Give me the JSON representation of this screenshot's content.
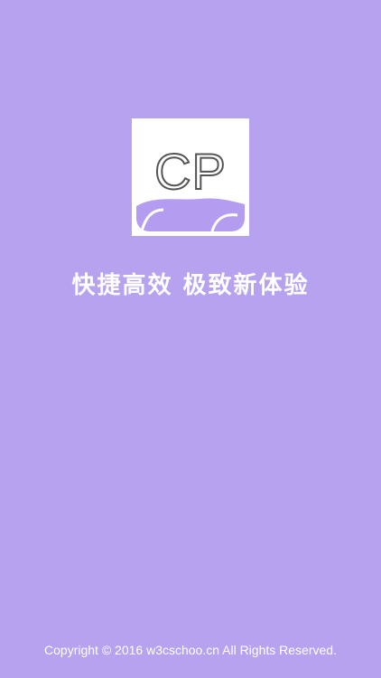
{
  "logo": {
    "text": "CP",
    "icon": "cp-logo-icon"
  },
  "tagline": "快捷高效 极致新体验",
  "footer": {
    "copyright": "Copyright © 2016 w3cschoo.cn All Rights Reserved."
  },
  "colors": {
    "background": "#b6a2ef",
    "logo_wave": "#b49df0",
    "text": "#ffffff"
  }
}
